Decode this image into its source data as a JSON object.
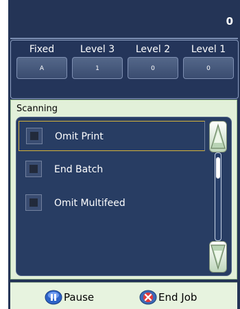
{
  "status": {
    "counter": "0"
  },
  "levels": [
    {
      "label": "Fixed",
      "value": "A"
    },
    {
      "label": "Level 3",
      "value": "1"
    },
    {
      "label": "Level 2",
      "value": "0"
    },
    {
      "label": "Level 1",
      "value": "0"
    }
  ],
  "scanning": {
    "title": "Scanning",
    "items": [
      {
        "label": "Omit Print",
        "checked": false
      },
      {
        "label": "End Batch",
        "checked": false
      },
      {
        "label": "Omit Multifeed",
        "checked": false
      }
    ],
    "scroll_up_icon": "scroll-up-icon",
    "scroll_down_icon": "scroll-down-icon"
  },
  "actions": {
    "pause_label": "Pause",
    "end_job_label": "End Job",
    "pause_icon": "pause-icon",
    "end_job_icon": "close-icon"
  },
  "colors": {
    "panel_bg": "#243456",
    "scan_panel_bg": "#e2f0d9",
    "selection_border": "#d5b33a",
    "button_bg": "#4a5e84"
  }
}
